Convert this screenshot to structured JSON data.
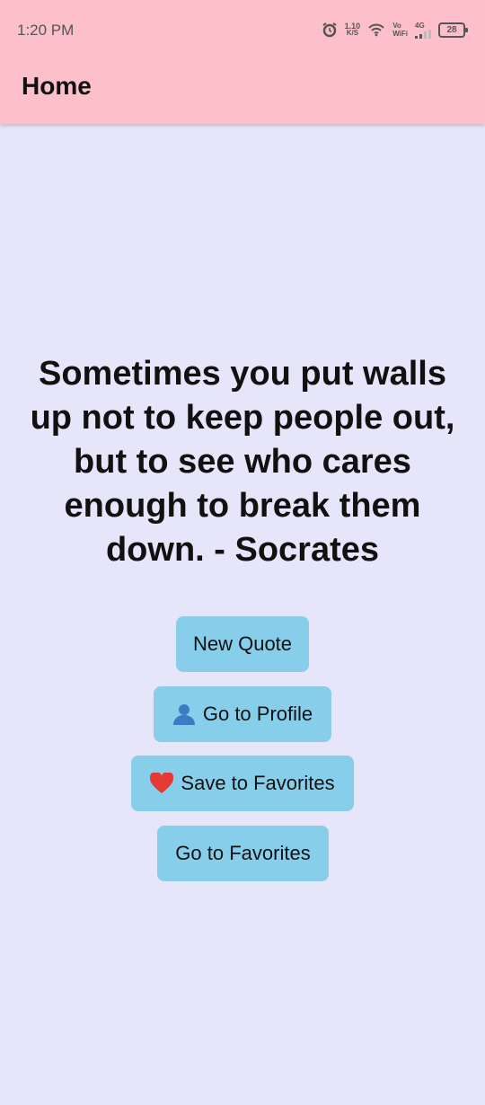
{
  "status_bar": {
    "time": "1:20 PM",
    "net_speed_value": "1.10",
    "net_speed_unit": "K/S",
    "vowifi_top": "Vo",
    "vowifi_bottom": "WiFi",
    "network_label": "4G",
    "battery_level": "28",
    "icons": [
      "alarm-icon",
      "wifi-icon",
      "signal-icon",
      "battery-icon"
    ]
  },
  "app_bar": {
    "title": "Home"
  },
  "quote": {
    "text": "Sometimes you put walls up not to keep people out, but to see who cares enough to break them down. - Socrates"
  },
  "buttons": {
    "new_quote": "New Quote",
    "go_to_profile": "Go to Profile",
    "save_to_favorites": "Save to Favorites",
    "go_to_favorites": "Go to Favorites"
  },
  "colors": {
    "app_bar_bg": "#fdbfca",
    "page_bg": "#e6e5fa",
    "button_bg": "#87ceeb"
  }
}
